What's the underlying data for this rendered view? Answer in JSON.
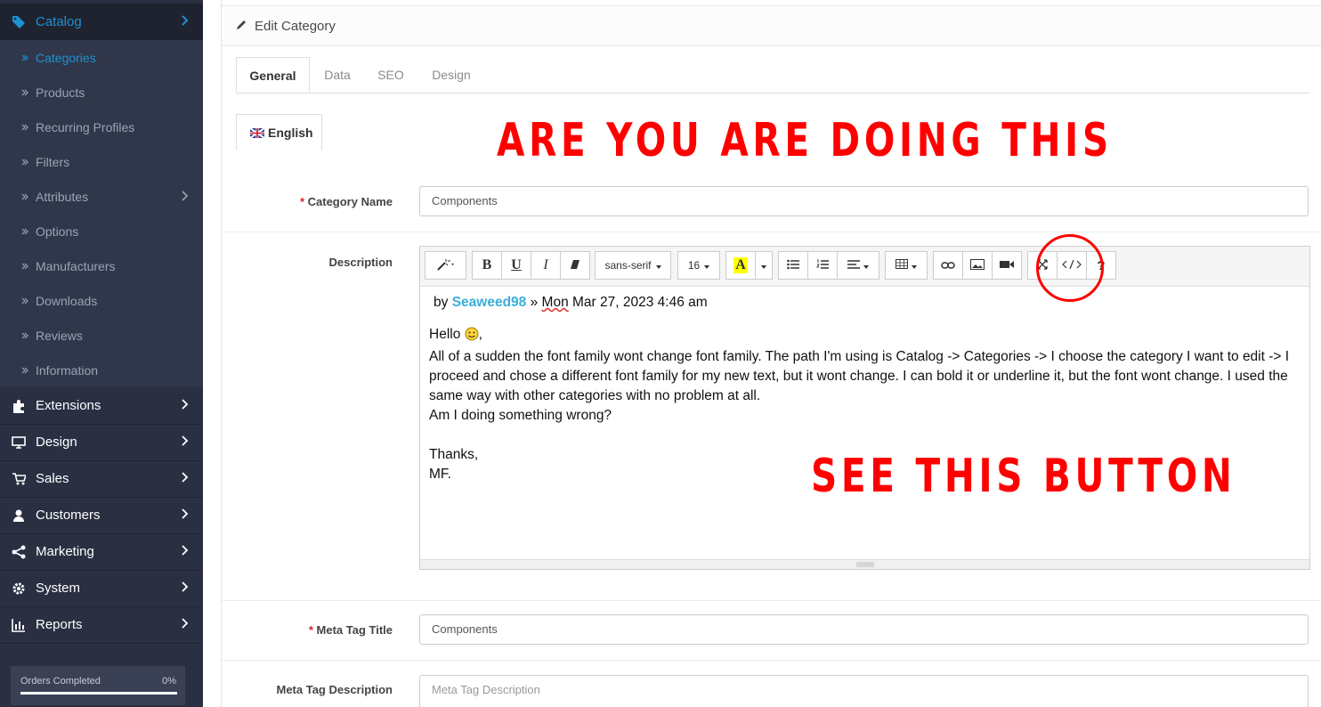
{
  "sidebar": {
    "catalog_label": "Catalog",
    "sub_items": [
      {
        "label": "Categories"
      },
      {
        "label": "Products"
      },
      {
        "label": "Recurring Profiles"
      },
      {
        "label": "Filters"
      },
      {
        "label": "Attributes"
      },
      {
        "label": "Options"
      },
      {
        "label": "Manufacturers"
      },
      {
        "label": "Downloads"
      },
      {
        "label": "Reviews"
      },
      {
        "label": "Information"
      }
    ],
    "top_items": [
      {
        "label": "Extensions"
      },
      {
        "label": "Design"
      },
      {
        "label": "Sales"
      },
      {
        "label": "Customers"
      },
      {
        "label": "Marketing"
      },
      {
        "label": "System"
      },
      {
        "label": "Reports"
      }
    ],
    "progress": {
      "label": "Orders Completed",
      "value": "0%"
    }
  },
  "panel": {
    "title": "Edit Category"
  },
  "tabs": [
    "General",
    "Data",
    "SEO",
    "Design"
  ],
  "language_tab": "English",
  "form": {
    "category_name_label": "Category Name",
    "category_name_value": "Components",
    "description_label": "Description",
    "meta_title_label": "Meta Tag Title",
    "meta_title_value": "Components",
    "meta_desc_label": "Meta Tag Description",
    "meta_desc_placeholder": "Meta Tag Description"
  },
  "toolbar": {
    "font_family": "sans-serif",
    "font_size": "16",
    "color_letter": "A",
    "help": "?"
  },
  "editor_content": {
    "by_prefix": "by",
    "author": "Seaweed98",
    "date_sep": "»",
    "date_mon": "Mon",
    "date_rest": "Mar 27, 2023 4:46 am",
    "hello": "Hello",
    "hello_after": ",",
    "paragraph": "All of a sudden the font family wont change font family. The path I'm using is Catalog -> Categories -> I choose the category I want to edit -> I proceed and chose a different font family for my new text, but it wont change. I can bold it or underline it, but the font wont change. I used the same way with other categories with no problem at all.",
    "question": "Am I doing something wrong?",
    "thanks": "Thanks,",
    "signature": "MF."
  },
  "overlays": {
    "top": "ARE YOU ARE DOING THIS",
    "bottom": "SEE THIS BUTTON",
    "color": "#ff0000"
  }
}
